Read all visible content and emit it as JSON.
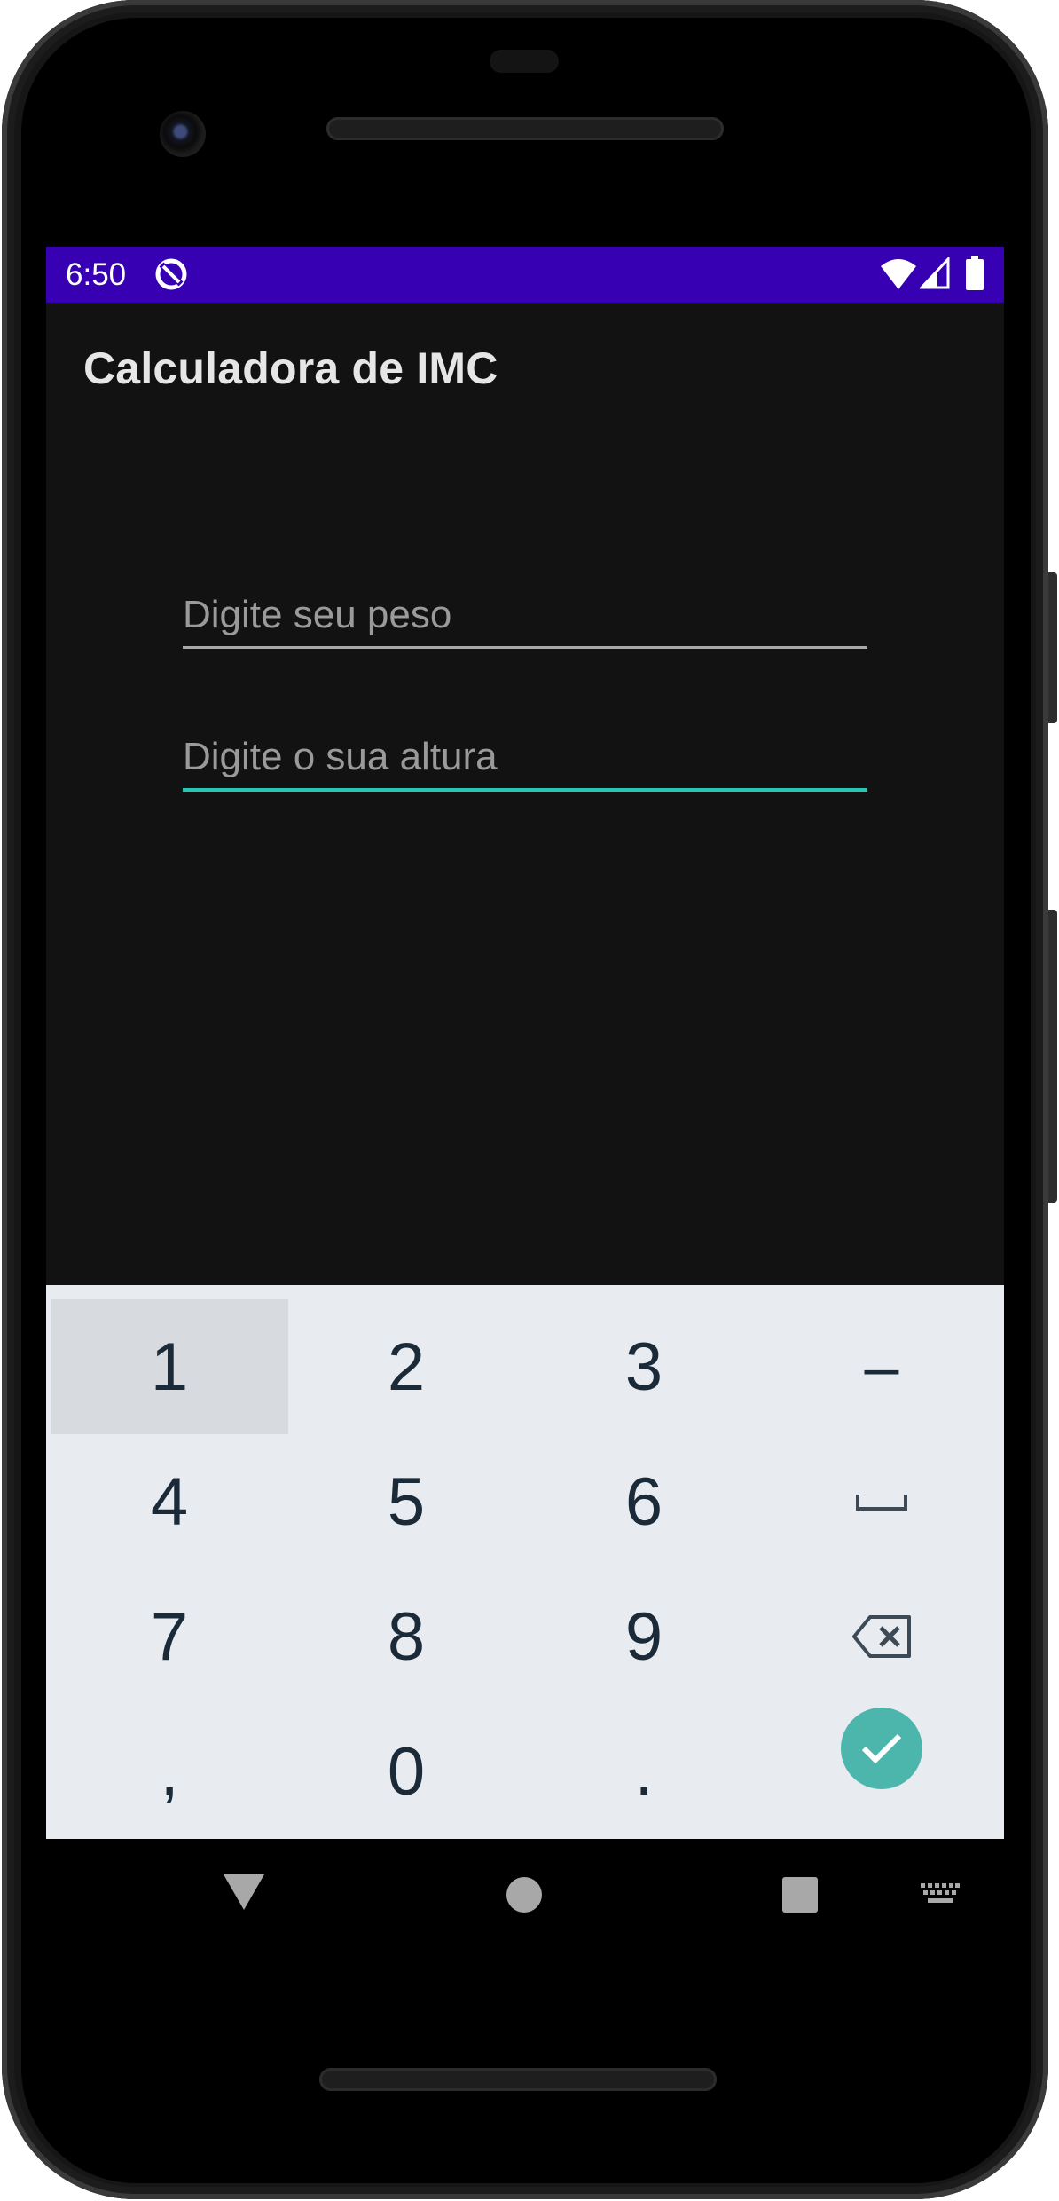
{
  "status_bar": {
    "time": "6:50",
    "background_color": "#3700b3",
    "icons": [
      "sync-icon",
      "wifi-icon",
      "cell-signal-icon",
      "battery-icon"
    ]
  },
  "app_bar": {
    "title": "Calculadora de IMC"
  },
  "form": {
    "peso": {
      "placeholder": "Digite seu peso",
      "value": ""
    },
    "altura": {
      "placeholder": "Digite o sua altura",
      "value": "",
      "focused": true,
      "accent_color": "#26c6b3"
    }
  },
  "keyboard": {
    "rows": [
      [
        "1",
        "2",
        "3",
        "–"
      ],
      [
        "4",
        "5",
        "6",
        "␣"
      ],
      [
        "7",
        "8",
        "9",
        "⌫"
      ],
      [
        ",",
        "0",
        ".",
        "✓"
      ]
    ],
    "pressed_key": "1",
    "done_color": "#4db6ac"
  },
  "nav_bar": {
    "icons": [
      "back-icon",
      "home-icon",
      "recents-icon",
      "keyboard-switch-icon"
    ]
  }
}
